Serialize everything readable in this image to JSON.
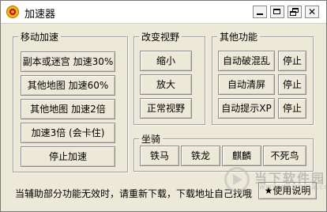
{
  "window": {
    "title": "加速器"
  },
  "groups": {
    "move": {
      "title": "移动加速",
      "buttons": [
        "副本或迷宫 加速30%",
        "其他地图 加速60%",
        "其他地图 加速2倍",
        "加速3倍 (会卡住)",
        "停止加速"
      ]
    },
    "view": {
      "title": "改变视野",
      "buttons": [
        "缩小",
        "放大",
        "正常视野"
      ]
    },
    "other": {
      "title": "其他功能",
      "rows": [
        {
          "label": "自动破混乱",
          "stop": "停止"
        },
        {
          "label": "自动清屏",
          "stop": "停止"
        },
        {
          "label": "自动提示XP",
          "stop": "停止"
        }
      ]
    },
    "mount": {
      "title": "坐骑",
      "buttons": [
        "铁马",
        "铁龙",
        "麒麟",
        "不死鸟"
      ]
    }
  },
  "footer": {
    "status": "当辅助部分功能无效时，请重新下载，下载地址自己找哦",
    "help_icon": "star-icon",
    "help_label": "使用说明"
  },
  "watermark": {
    "text": "当下软件园",
    "url": "www.downxia.com"
  }
}
